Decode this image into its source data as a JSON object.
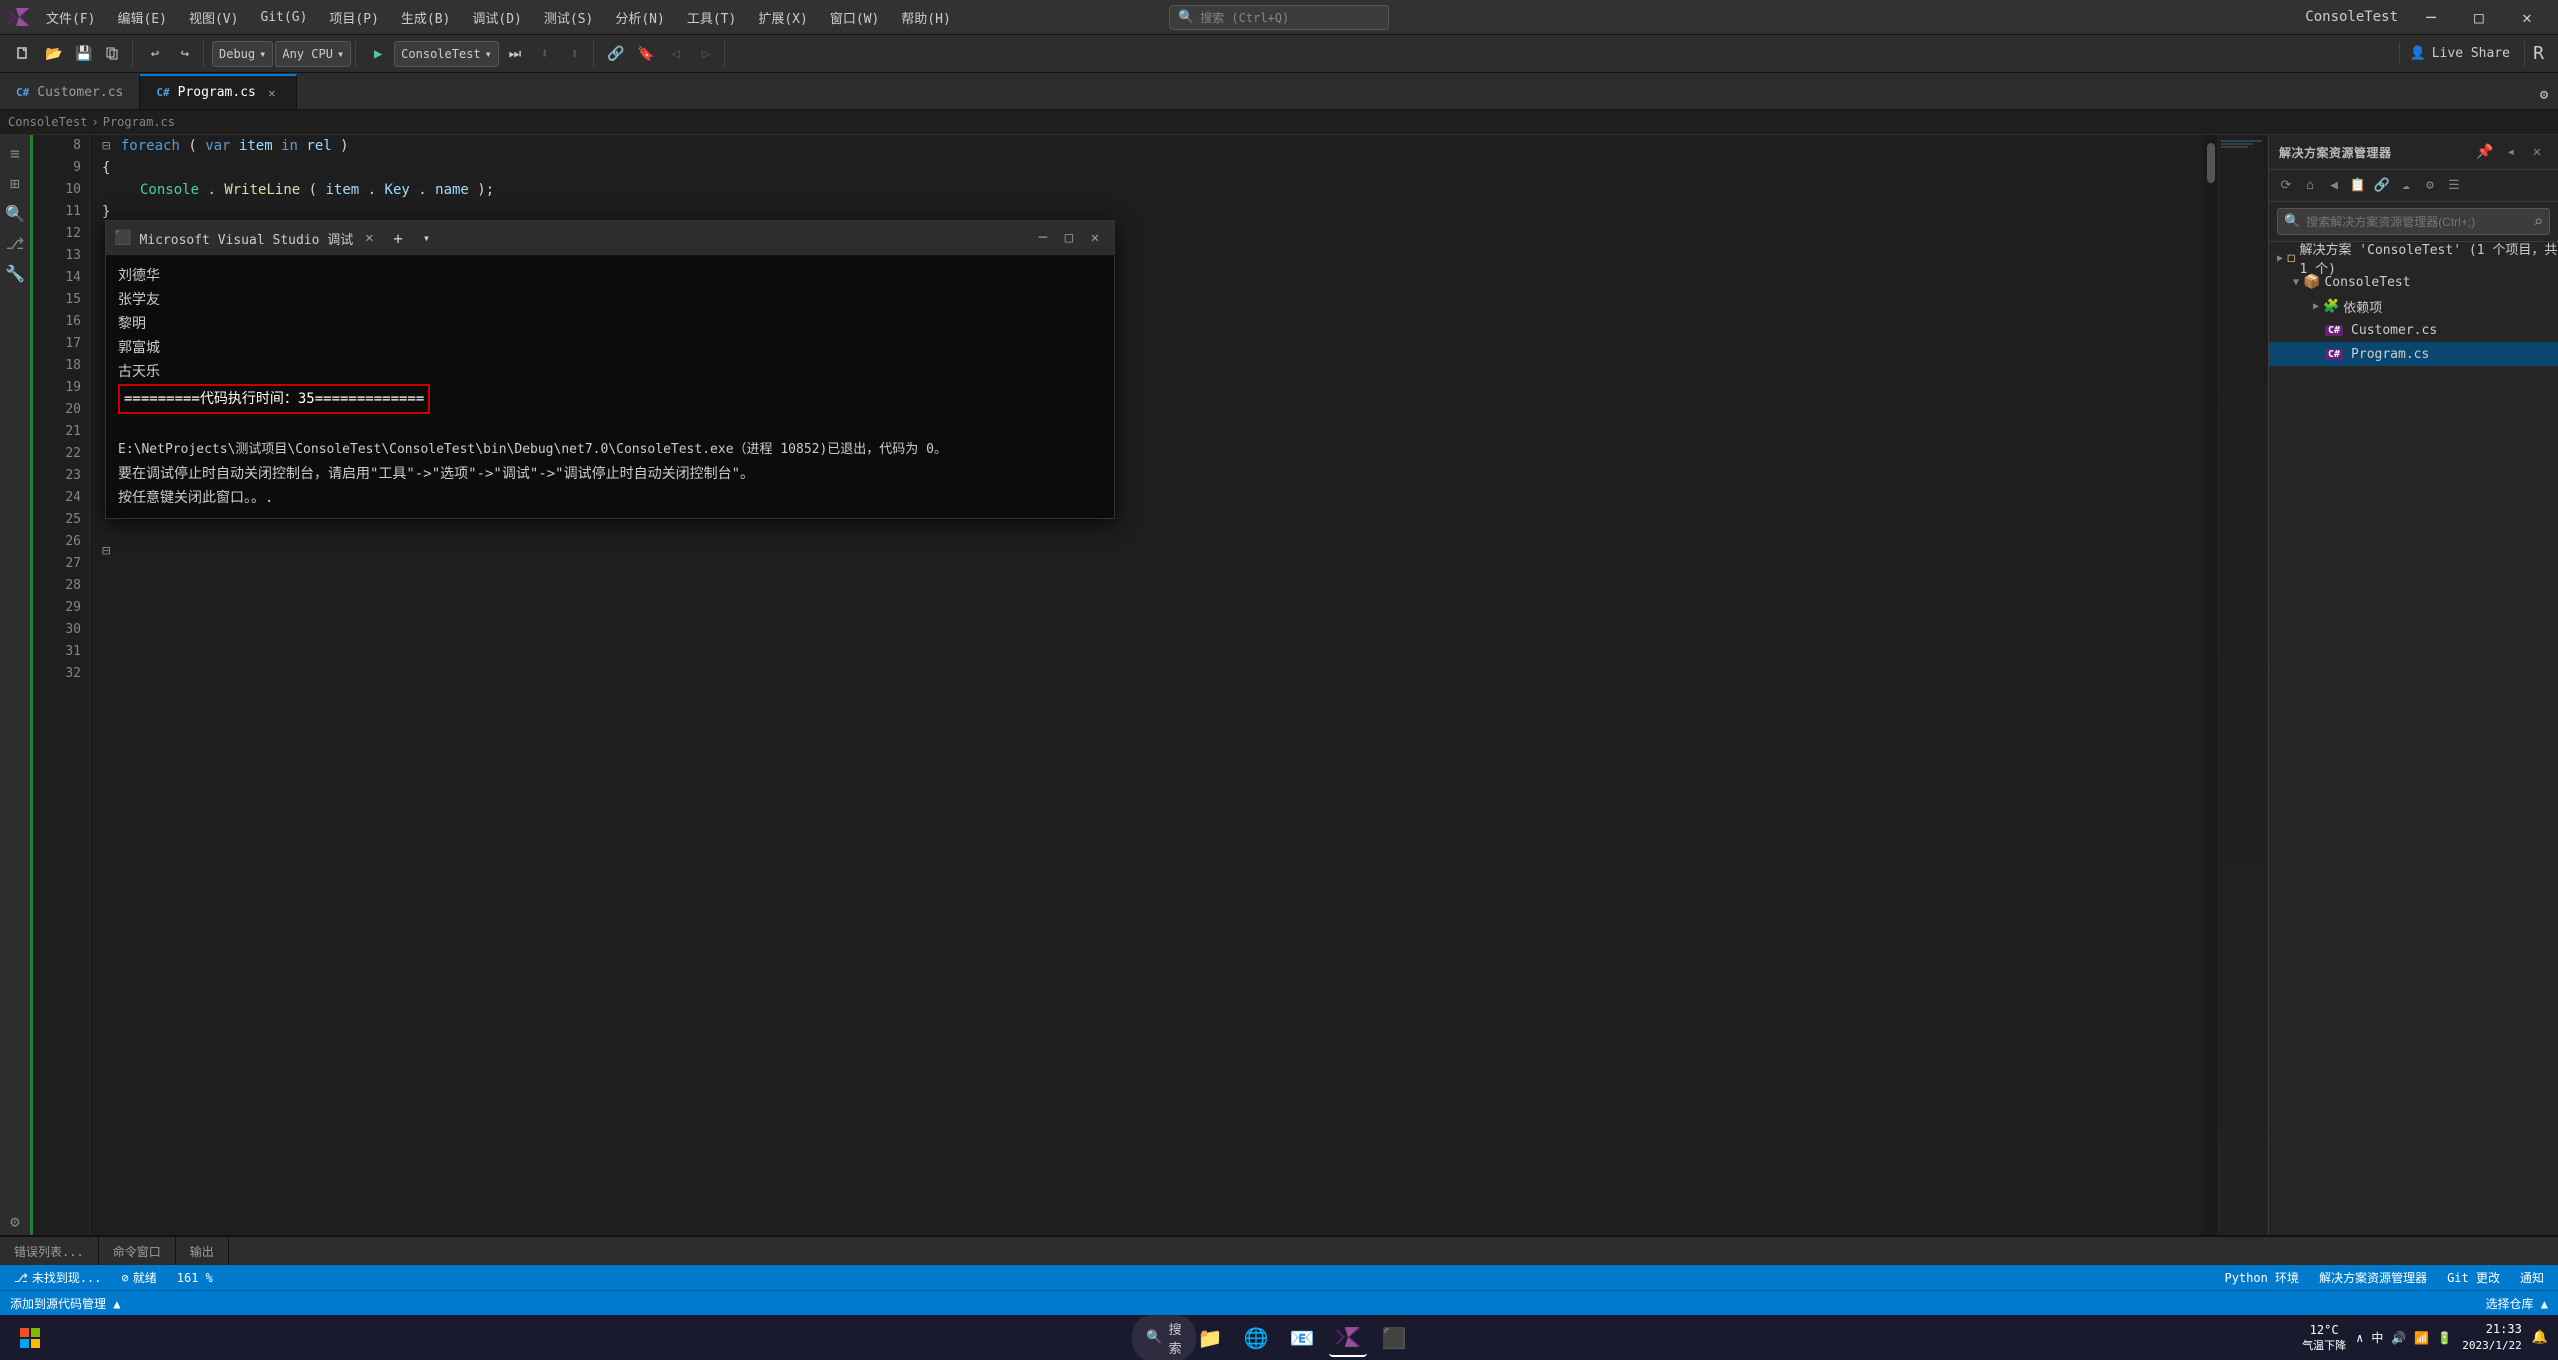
{
  "window": {
    "title": "ConsoleTest",
    "logo": "⬟"
  },
  "titlebar": {
    "menus": [
      "文件(F)",
      "编辑(E)",
      "视图(V)",
      "Git(G)",
      "项目(P)",
      "生成(B)",
      "调试(D)",
      "测试(S)",
      "分析(N)",
      "工具(T)",
      "扩展(X)",
      "窗口(W)",
      "帮助(H)"
    ],
    "search_placeholder": "搜索 (Ctrl+Q)",
    "title": "ConsoleTest",
    "min": "─",
    "max": "□",
    "close": "✕"
  },
  "toolbar": {
    "debug_config": "Debug",
    "platform": "Any CPU",
    "run_target": "ConsoleTest",
    "live_share": "Live Share"
  },
  "tabs": [
    {
      "name": "Customer.cs",
      "type": "cs",
      "active": false,
      "modified": false
    },
    {
      "name": "Program.cs",
      "type": "cs",
      "active": true,
      "modified": true
    }
  ],
  "breadcrumb": {
    "path": "Program.cs"
  },
  "editor": {
    "lines": [
      {
        "num": 8,
        "content_html": "<span class='fold-icon'>⊟</span><span class='kw'>foreach</span> (<span class='kw'>var</span> <span class='var'>item</span> <span class='kw'>in</span> <span class='var'>rel</span>)"
      },
      {
        "num": 9,
        "content_html": "{"
      },
      {
        "num": 10,
        "content_html": "&nbsp;&nbsp;&nbsp;&nbsp;<span class='type'>Console</span>.<span class='method'>WriteLine</span>(<span class='var'>item</span>.<span class='prop'>Key</span>.<span class='prop'>name</span>);"
      },
      {
        "num": 11,
        "content_html": "}"
      },
      {
        "num": 12,
        "content_html": ""
      },
      {
        "num": 13,
        "content_html": ""
      },
      {
        "num": 14,
        "content_html": ""
      },
      {
        "num": 15,
        "content_html": ""
      },
      {
        "num": 16,
        "content_html": ""
      },
      {
        "num": 17,
        "content_html": ""
      },
      {
        "num": 18,
        "content_html": ""
      },
      {
        "num": 19,
        "content_html": ""
      },
      {
        "num": 20,
        "content_html": ""
      },
      {
        "num": 21,
        "content_html": ""
      },
      {
        "num": 22,
        "content_html": "<span class='fold-icon'>⊟</span>"
      },
      {
        "num": 23,
        "content_html": ""
      },
      {
        "num": 24,
        "content_html": ""
      },
      {
        "num": 25,
        "content_html": ""
      },
      {
        "num": 26,
        "content_html": ""
      },
      {
        "num": 27,
        "content_html": ""
      },
      {
        "num": 28,
        "content_html": ""
      },
      {
        "num": 29,
        "content_html": ""
      },
      {
        "num": 30,
        "content_html": ""
      },
      {
        "num": 31,
        "content_html": ""
      },
      {
        "num": 32,
        "content_html": ""
      }
    ]
  },
  "terminal": {
    "title": "Microsoft Visual Studio 调试",
    "lines": [
      {
        "type": "normal",
        "text": "刘德华"
      },
      {
        "type": "normal",
        "text": "张学友"
      },
      {
        "type": "normal",
        "text": "黎明"
      },
      {
        "type": "normal",
        "text": "郭富城"
      },
      {
        "type": "normal",
        "text": "古天乐"
      },
      {
        "type": "highlight",
        "text": "=========代码执行时间：35============="
      },
      {
        "type": "normal",
        "text": ""
      },
      {
        "type": "path",
        "text": "E:\\NetProjects\\测试项目\\ConsoleTest\\ConsoleTest\\bin\\Debug\\net7.0\\ConsoleTest.exe（进程 10852)已退出，代码为 0。"
      },
      {
        "type": "normal",
        "text": "要在调试停止时自动关闭控制台，请启用\"工具\"->\"选项\"->\"调试\"->\"调试停止时自动关闭控制台\"。"
      },
      {
        "type": "normal",
        "text": "按任意键关闭此窗口。。."
      }
    ]
  },
  "right_panel": {
    "title": "解决方案资源管理器",
    "search_placeholder": "搜索解决方案资源管理器(Ctrl+;)",
    "solution": {
      "label": "解决方案 'ConsoleTest' (1 个项目，共 1 个)",
      "project": "ConsoleTest",
      "dependencies": "依赖项",
      "files": [
        "Customer.cs",
        "Program.cs"
      ]
    }
  },
  "bottom_tabs": [
    {
      "label": "错误列表...",
      "active": false
    },
    {
      "label": "命令窗口",
      "active": false
    },
    {
      "label": "输出",
      "active": false
    }
  ],
  "status_bar": {
    "zoom": "161 %",
    "status": "就绪",
    "branch": "未找到现...",
    "python_env": "Python 环境",
    "solution_explorer": "解决方案资源管理器",
    "git_changes": "Git 更改",
    "notifications": "通知",
    "add_source": "添加到源代码管理 ▲",
    "select_repo": "选择仓库 ▲"
  },
  "taskbar": {
    "time": "21:33",
    "date": "2023/1/22",
    "weather": "12°C\n气温下降",
    "search_placeholder": "搜索"
  },
  "icons": {
    "search": "🔍",
    "settings": "⚙",
    "close": "✕",
    "minimize": "─",
    "maximize": "□",
    "folder": "📁",
    "file_cs": "C#",
    "git": "⎇",
    "add": "+",
    "chevron_right": "›",
    "chevron_down": "⌄",
    "arrow_right": "▶",
    "bell": "🔔"
  }
}
